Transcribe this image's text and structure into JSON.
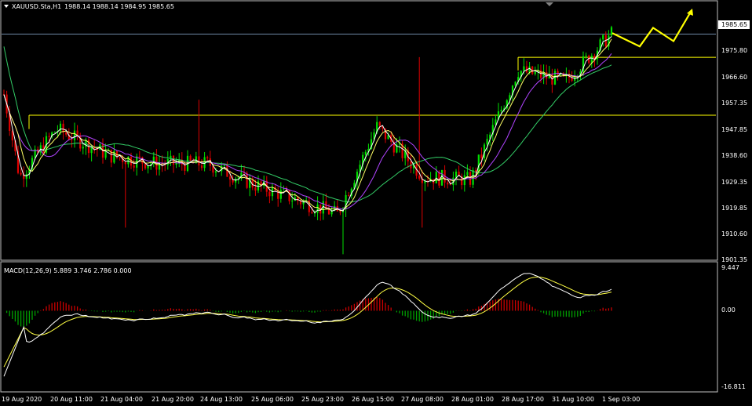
{
  "main": {
    "symbol_label": "XAUUSD.Sta,H1",
    "ohlc_label": "1988.14 1988.14 1984.95 1985.65",
    "bid_label": "1985.65",
    "price_ticks": [
      "1985.65",
      "1975.80",
      "1966.60",
      "1957.35",
      "1947.85",
      "1938.60",
      "1929.35",
      "1919.85",
      "1910.60",
      "1901.35"
    ]
  },
  "macd": {
    "label": "MACD(12,26,9) 5.889 3.746 2.786 0.000",
    "ticks": [
      "9.447",
      "0.00",
      "-16.811"
    ]
  },
  "time_ticks": [
    "19 Aug 2020",
    "20 Aug 11:00",
    "21 Aug 04:00",
    "21 Aug 20:00",
    "24 Aug 13:00",
    "25 Aug 06:00",
    "25 Aug 23:00",
    "26 Aug 15:00",
    "27 Aug 08:00",
    "28 Aug 01:00",
    "28 Aug 17:00",
    "31 Aug 10:00",
    "1 Sep 03:00"
  ],
  "colors": {
    "background": "#000000",
    "bull_candle": "#00e000",
    "bear_candle": "#e00000",
    "ma_fast": "#ffffff",
    "ma_mid": "#ffff66",
    "ma_slow_purple": "#b044ff",
    "ma_slow_green": "#33cc66",
    "level_line": "#ffff00",
    "bid_line": "#6f8aa8",
    "arrow": "#ffff00",
    "macd_hist_pos": "#cc0000",
    "macd_hist_neg": "#00a000",
    "macd_line": "#ffffff",
    "signal_line": "#ffff44"
  },
  "chart_data": {
    "type": "candlestick",
    "symbol": "XAUUSD.Sta",
    "timeframe": "H1",
    "y_range": [
      1901.35,
      1994.9
    ],
    "horizontal_levels": [
      1976.9,
      1955.2
    ],
    "bid": 1985.65,
    "anchors": [
      {
        "time": "19 Aug 2020",
        "close": 1963
      },
      {
        "time": "19 Aug",
        "close": 1932
      },
      {
        "time": "20 Aug 11:00",
        "close": 1950
      },
      {
        "time": "21 Aug 04:00",
        "close": 1940
      },
      {
        "time": "21 Aug 20:00",
        "close": 1937
      },
      {
        "time": "24 Aug 13:00",
        "close": 1937
      },
      {
        "time": "25 Aug 06:00",
        "close": 1929
      },
      {
        "time": "25 Aug 23:00",
        "close": 1918
      },
      {
        "time": "26 Aug 15:00",
        "close": 1951
      },
      {
        "time": "27 Aug 08:00",
        "close": 1932
      },
      {
        "time": "28 Aug 01:00",
        "close": 1931
      },
      {
        "time": "28 Aug 17:00",
        "close": 1972
      },
      {
        "time": "31 Aug 10:00",
        "close": 1968
      },
      {
        "time": "1 Sep 03:00",
        "close": 1986
      }
    ],
    "forecast_arrow": [
      1986,
      1981,
      1988,
      1983,
      1994
    ]
  }
}
